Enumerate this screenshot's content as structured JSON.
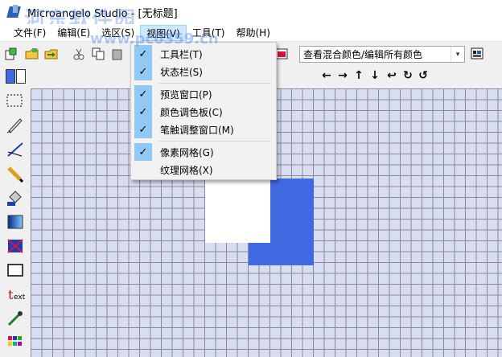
{
  "window": {
    "title": "Microangelo Studio - [无标题]"
  },
  "watermark": {
    "text": "河东软件园",
    "url": "www.pc0359.cn"
  },
  "menubar": {
    "items": [
      {
        "label": "文件(F)"
      },
      {
        "label": "编辑(E)"
      },
      {
        "label": "选区(S)"
      },
      {
        "label": "视图(V)"
      },
      {
        "label": "工具(T)"
      },
      {
        "label": "帮助(H)"
      }
    ]
  },
  "view_menu": {
    "items": [
      {
        "label": "工具栏(T)",
        "checked": true
      },
      {
        "label": "状态栏(S)",
        "checked": true
      },
      {
        "label": "预览窗口(P)",
        "checked": true
      },
      {
        "label": "颜色调色板(C)",
        "checked": true
      },
      {
        "label": "笔触调整窗口(M)",
        "checked": true
      },
      {
        "label": "像素网格(G)",
        "checked": true
      },
      {
        "label": "纹理网格(X)",
        "checked": false
      }
    ],
    "check_glyph": "✓"
  },
  "toolbar": {
    "view_combo_value": "查看混合颜色/编辑所有颜色",
    "combo_arrow": "▾"
  },
  "colors": {
    "foreground": "#4169e1",
    "background": "#ffffff",
    "canvas": "#d9ddf2",
    "menu_highlight": "#cce8ff",
    "check_highlight": "#90c8f6"
  },
  "arrows": [
    "←",
    "→",
    "↑",
    "↓",
    "↩",
    "↻",
    "↺"
  ],
  "left_tools": [
    "selection-icon",
    "brush-icon",
    "line-icon",
    "pencil-icon",
    "fill-icon",
    "gradient-icon",
    "replace-color-icon",
    "rectangle-icon",
    "text-icon",
    "eyedropper-icon",
    "palette-icon"
  ]
}
